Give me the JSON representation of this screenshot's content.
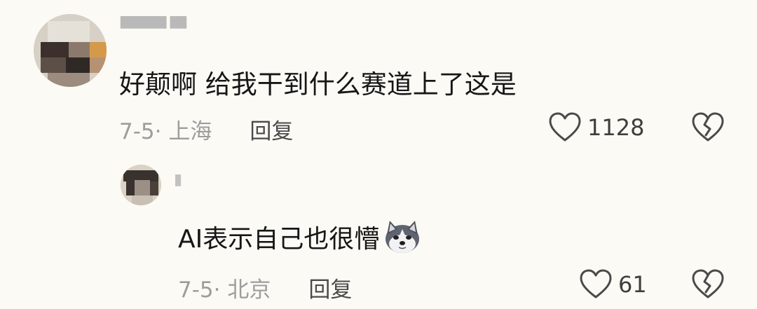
{
  "comments": [
    {
      "username": "▀▀▀ ▀",
      "text": "好颠啊  给我干到什么赛道上了这是",
      "date_location": "7-5· 上海",
      "reply_label": "回复",
      "likes": "1128"
    }
  ],
  "replies": [
    {
      "username": "▮",
      "text": "AI表示自己也很懵",
      "date_location": "7-5· 北京",
      "reply_label": "回复",
      "likes": "61"
    }
  ],
  "icons": {
    "like": "heart-outline-icon",
    "dislike": "broken-heart-icon",
    "emoji": "husky-dog-emoji-icon"
  },
  "colors": {
    "background": "#fbfaf5",
    "text": "#161616",
    "meta": "#9d9d9d",
    "reply": "#4a4a4a"
  }
}
